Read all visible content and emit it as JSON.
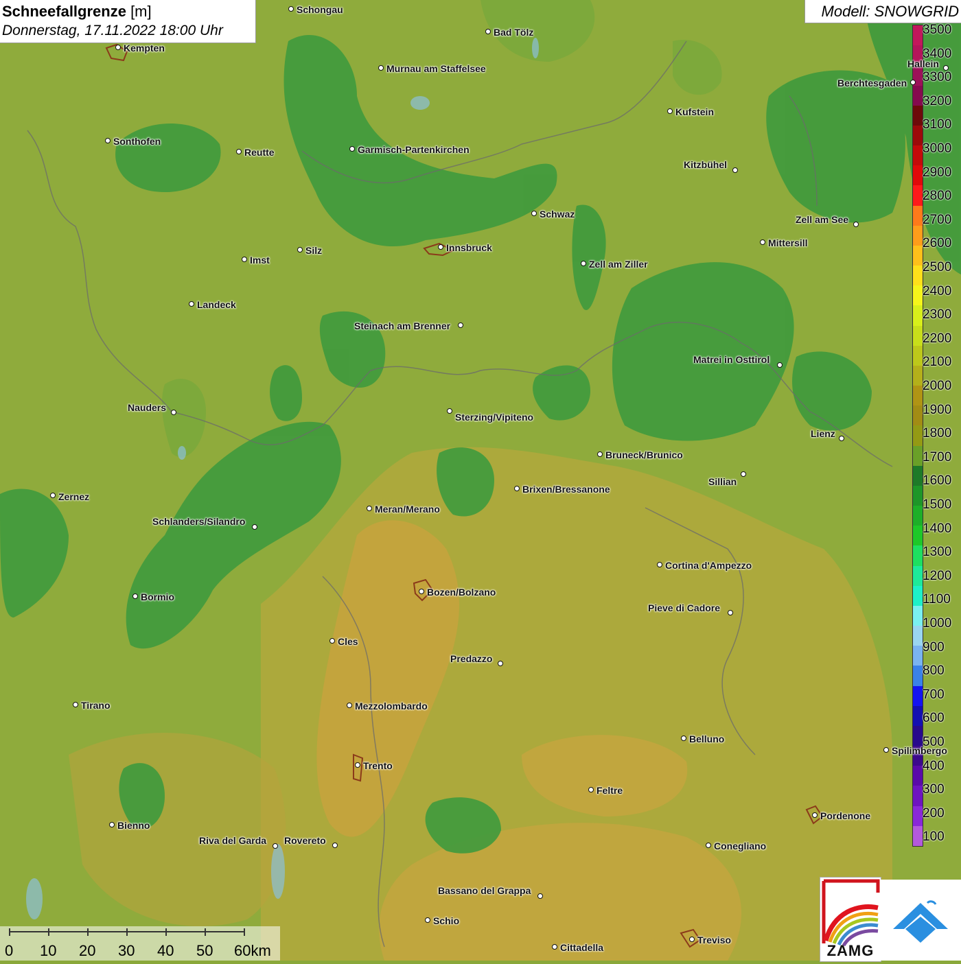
{
  "header": {
    "title_bold": "Schneefallgrenze",
    "title_unit": " [m]",
    "datetime": "Donnerstag, 17.11.2022 18:00 Uhr",
    "model": "Modell: SNOWGRID"
  },
  "legend": {
    "colors": [
      "#c2185b",
      "#b3155a",
      "#9c1058",
      "#850a4e",
      "#6d0a0a",
      "#9c0a0a",
      "#c40a0a",
      "#e00a0a",
      "#ff1a1a",
      "#ff7a1a",
      "#ff9d1a",
      "#ffc01a",
      "#ffe01a",
      "#f5f51a",
      "#d8ef1a",
      "#c8de1a",
      "#bdc81a",
      "#b4b01a",
      "#b09414",
      "#a28c14",
      "#949a14",
      "#6aa028",
      "#1e7a28",
      "#1e9628",
      "#1eaf28",
      "#1ec828",
      "#1ee060",
      "#1eea9a",
      "#1ef0c8",
      "#7af0f0",
      "#9ad6f0",
      "#7ab4f0",
      "#3a82e8",
      "#1414f0",
      "#1410b0",
      "#280a8c",
      "#3c0a8c",
      "#5a0aa8",
      "#6e14c0",
      "#8a28d8",
      "#b45adc"
    ],
    "labels": [
      "3500",
      "3400",
      "3300",
      "3200",
      "3100",
      "3000",
      "2900",
      "2800",
      "2700",
      "2600",
      "2500",
      "2400",
      "2300",
      "2200",
      "2100",
      "2000",
      "1900",
      "1800",
      "1700",
      "1600",
      "1500",
      "1400",
      "1300",
      "1200",
      "1100",
      "1000",
      "900",
      "800",
      "700",
      "600",
      "500",
      "400",
      "300",
      "200",
      "100"
    ]
  },
  "places": [
    {
      "name": "Schongau"
    },
    {
      "name": "Kempten"
    },
    {
      "name": "Bad Tölz"
    },
    {
      "name": "Murnau am Staffelsee"
    },
    {
      "name": "Berchtesgaden"
    },
    {
      "name": "Kufstein"
    },
    {
      "name": "Sonthofen"
    },
    {
      "name": "Reutte"
    },
    {
      "name": "Garmisch-Partenkirchen"
    },
    {
      "name": "Kitzbühel"
    },
    {
      "name": "Schwaz"
    },
    {
      "name": "Zell am See"
    },
    {
      "name": "Mittersill"
    },
    {
      "name": "Imst"
    },
    {
      "name": "Silz"
    },
    {
      "name": "Innsbruck"
    },
    {
      "name": "Zell am Ziller"
    },
    {
      "name": "Landeck"
    },
    {
      "name": "Steinach am Brenner"
    },
    {
      "name": "Matrei in Osttirol"
    },
    {
      "name": "Nauders"
    },
    {
      "name": "Sterzing/Vipiteno"
    },
    {
      "name": "Lienz"
    },
    {
      "name": "Bruneck/Brunico"
    },
    {
      "name": "Sillian"
    },
    {
      "name": "Zernez"
    },
    {
      "name": "Brixen/Bressanone"
    },
    {
      "name": "Meran/Merano"
    },
    {
      "name": "Schlanders/Silandro"
    },
    {
      "name": "Cortina d'Ampezzo"
    },
    {
      "name": "Bozen/Bolzano"
    },
    {
      "name": "Bormio"
    },
    {
      "name": "Pieve di Cadore"
    },
    {
      "name": "Cles"
    },
    {
      "name": "Predazzo"
    },
    {
      "name": "Tirano"
    },
    {
      "name": "Mezzolombardo"
    },
    {
      "name": "Belluno"
    },
    {
      "name": "Spilimbergo"
    },
    {
      "name": "Trento"
    },
    {
      "name": "Feltre"
    },
    {
      "name": "Pordenone"
    },
    {
      "name": "Bienno"
    },
    {
      "name": "Riva del Garda"
    },
    {
      "name": "Rovereto"
    },
    {
      "name": "Conegliano"
    },
    {
      "name": "Bassano del Grappa"
    },
    {
      "name": "Schio"
    },
    {
      "name": "Treviso"
    },
    {
      "name": "Cittadella"
    },
    {
      "name": "Hallein"
    }
  ],
  "scale": {
    "labels": [
      "0",
      "10",
      "20",
      "30",
      "40",
      "50",
      "60km"
    ]
  },
  "logos": {
    "zamg": "ZAMG"
  },
  "map_colors": {
    "base": "#8aa83a",
    "dark_green": "#3c9a3c",
    "olive": "#a8a83a",
    "ochre": "#c8a83c"
  }
}
